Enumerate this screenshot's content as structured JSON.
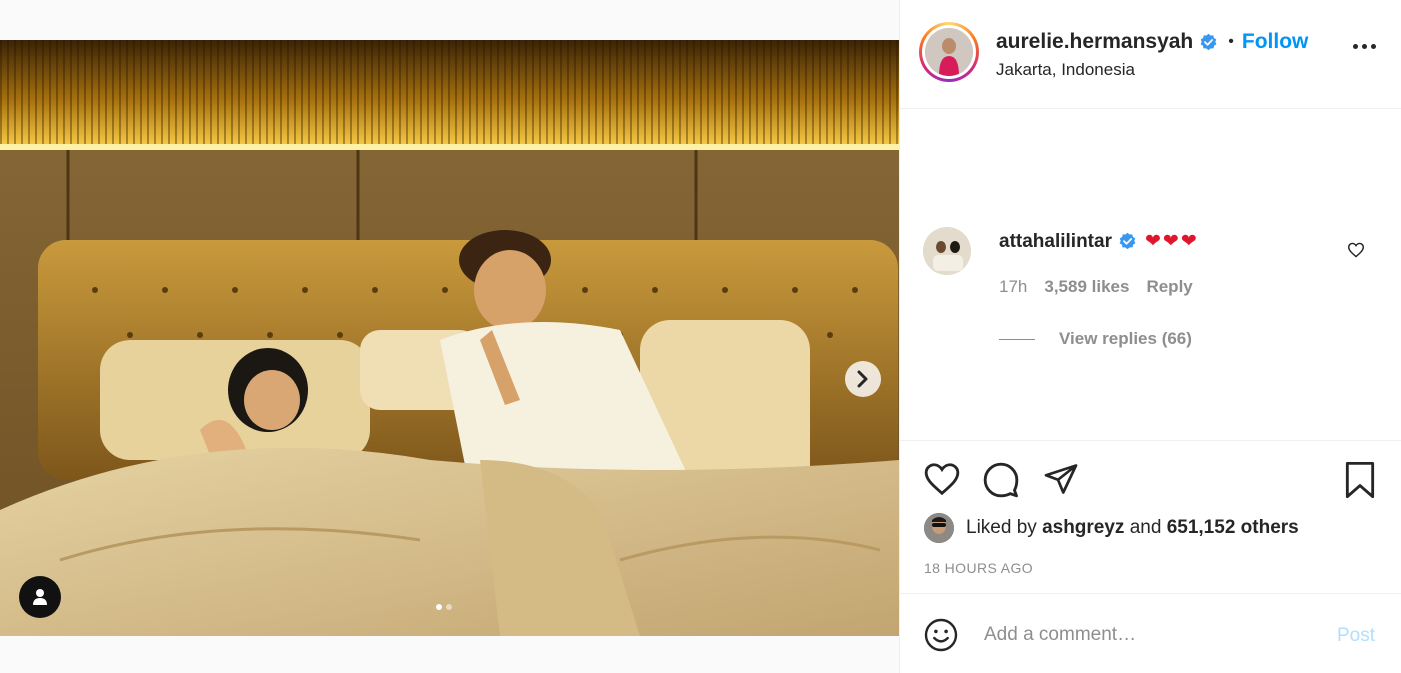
{
  "post": {
    "author": {
      "username": "aurelie.hermansyah",
      "verified": true,
      "location": "Jakarta, Indonesia",
      "follow_label": "Follow",
      "separator": "•"
    },
    "media": {
      "carousel_dots": 2,
      "active_dot": 0
    },
    "comment": {
      "username": "attahalilintar",
      "verified": true,
      "text": "❤❤❤",
      "time": "17h",
      "likes": "3,589 likes",
      "reply_label": "Reply",
      "view_replies": "View replies (66)"
    },
    "likes": {
      "prefix": "Liked by",
      "liker": "ashgreyz",
      "conjunction": "and",
      "others": "651,152 others"
    },
    "timestamp": "18 HOURS AGO",
    "comment_box": {
      "placeholder": "Add a comment…",
      "post_label": "Post"
    }
  },
  "colors": {
    "accent": "#0095f6",
    "post_disabled": "#b2dffc",
    "heart": "#e0172c",
    "muted": "#8e8e8e",
    "text": "#262626",
    "border": "#efefef"
  },
  "icons": {
    "like": "heart-icon",
    "comment": "comment-bubble-icon",
    "share": "paper-plane-icon",
    "save": "bookmark-icon",
    "emoji": "smiley-icon",
    "more": "ellipsis-icon",
    "next": "chevron-right-icon",
    "user_tag": "user-icon"
  }
}
